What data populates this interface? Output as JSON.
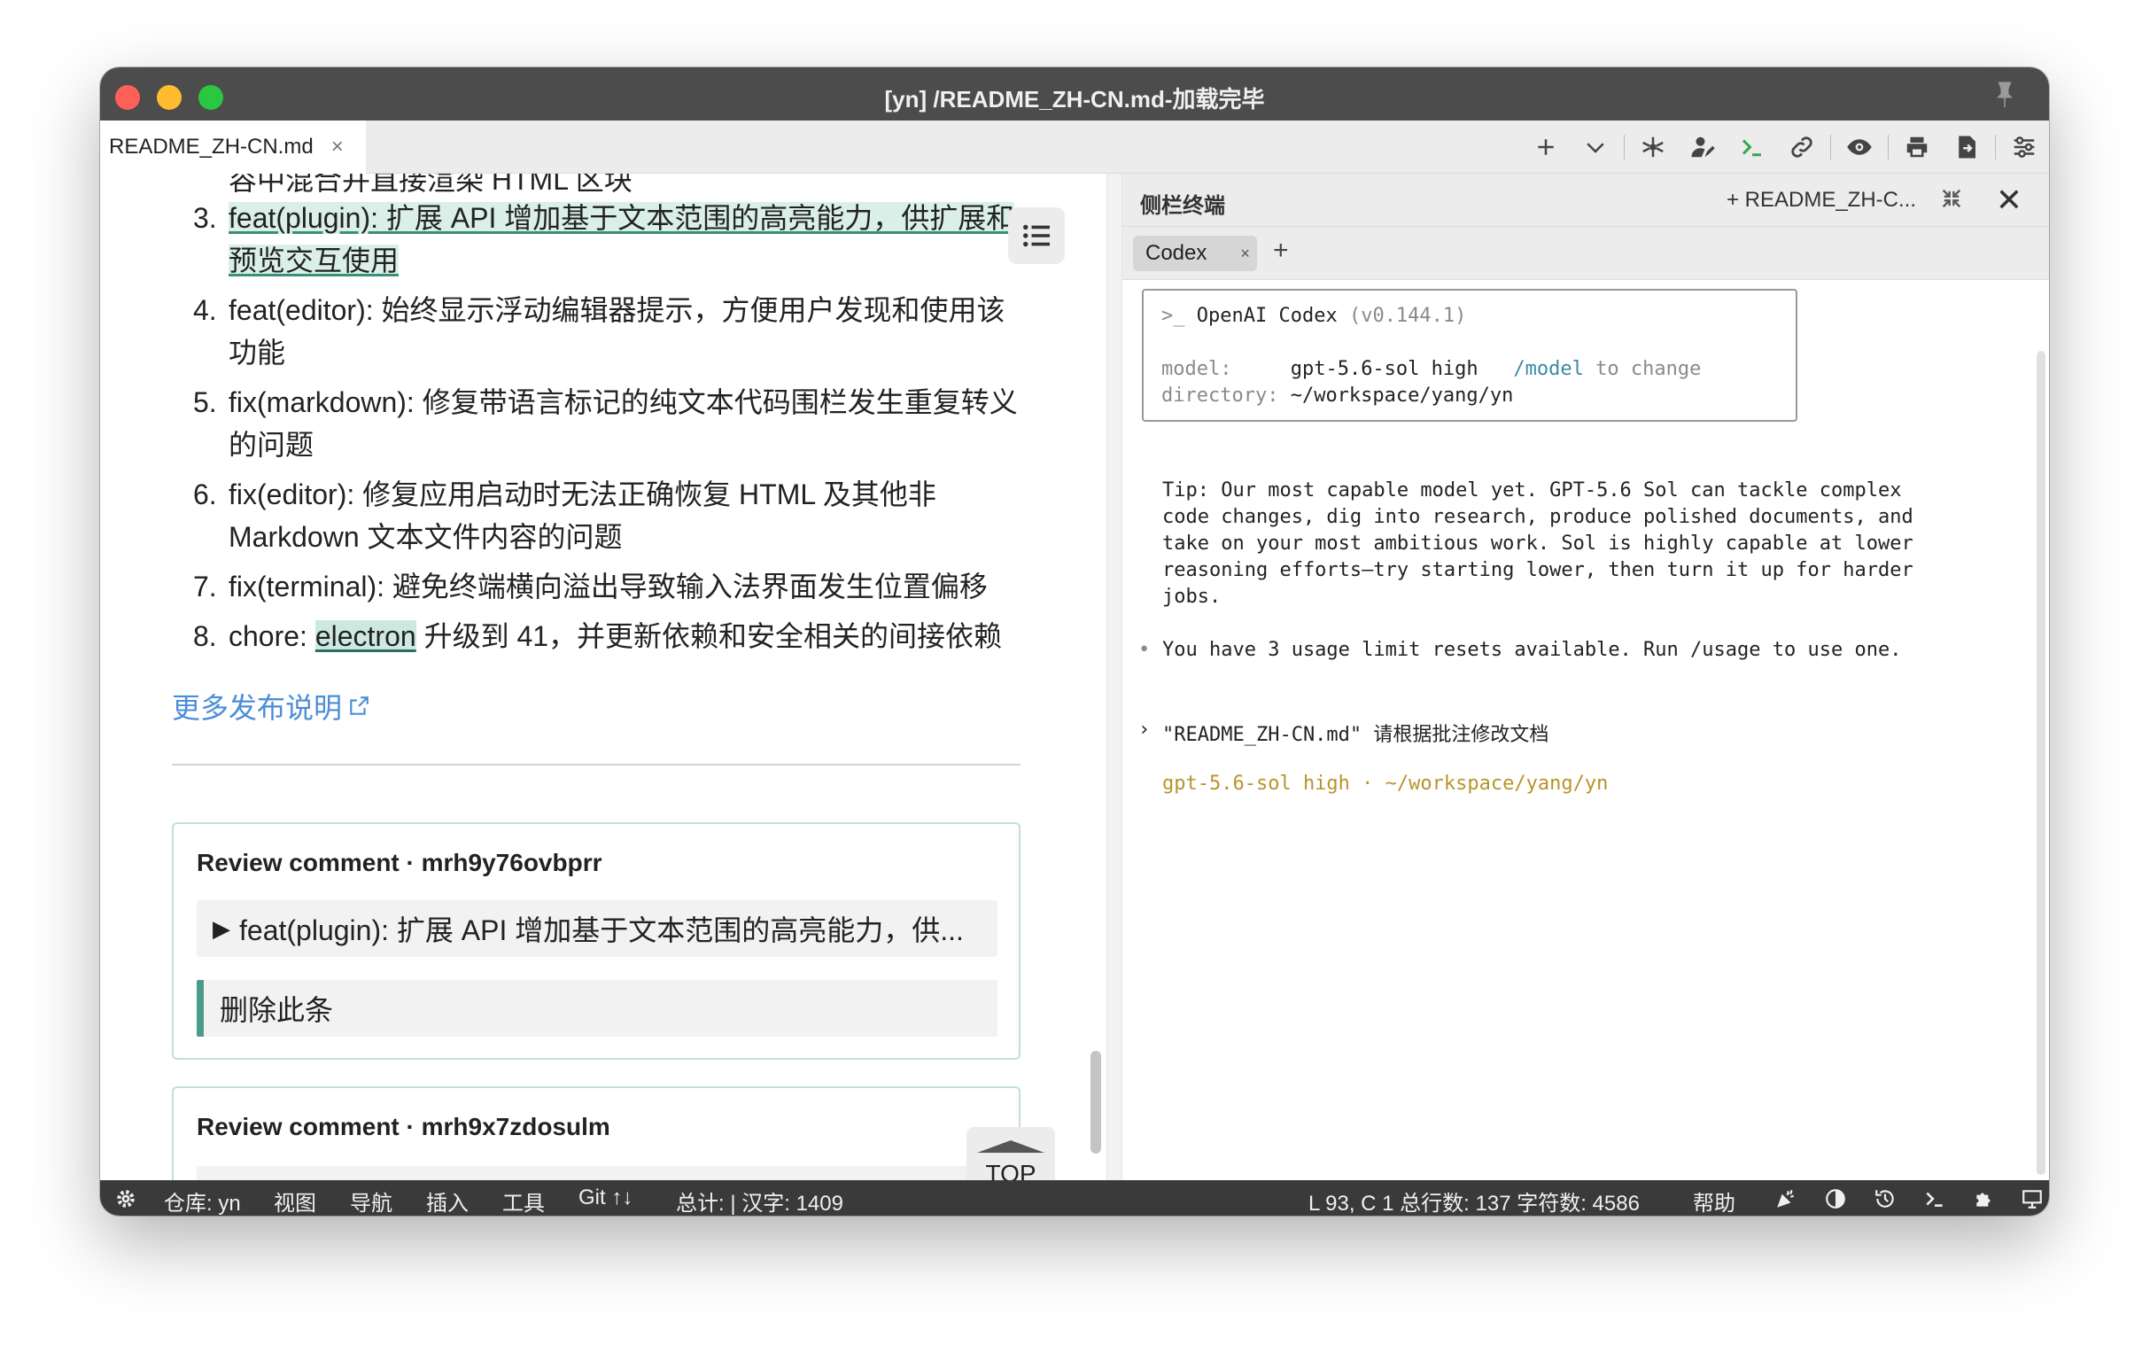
{
  "window": {
    "title": "[yn] /README_ZH-CN.md-加载完毕"
  },
  "tabs": [
    {
      "label": "README_ZH-CN.md",
      "close": "×"
    }
  ],
  "editor": {
    "cutoff_text": "容中混合并直接渲染 HTML 区块",
    "items": [
      {
        "num": "3.",
        "prefix": "",
        "hl": "feat(plugin): 扩展 API 增加基于文本范围的高亮能力，供扩展和预览交互使用",
        "rest": ""
      },
      {
        "num": "4.",
        "text": "feat(editor): 始终显示浮动编辑器提示，方便用户发现和使用该功能"
      },
      {
        "num": "5.",
        "text": "fix(markdown): 修复带语言标记的纯文本代码围栏发生重复转义的问题"
      },
      {
        "num": "6.",
        "text": "fix(editor): 修复应用启动时无法正确恢复 HTML 及其他非 Markdown 文本文件内容的问题"
      },
      {
        "num": "7.",
        "text": "fix(terminal): 避免终端横向溢出导致输入法界面发生位置偏移"
      },
      {
        "num": "8.",
        "prefix": "chore: ",
        "hl": "electron",
        "rest": " 升级到 41，并更新依赖和安全相关的间接依赖"
      }
    ],
    "more_link": "更多发布说明",
    "reviews": [
      {
        "title": "Review comment · mrh9y76ovbprr",
        "quote": "feat(plugin): 扩展 API 增加基于文本范围的高亮能力，供...",
        "body": "删除此条"
      },
      {
        "title": "Review comment · mrh9x7zdosulm"
      }
    ],
    "top_button": "TOP"
  },
  "terminal": {
    "title": "侧栏终端",
    "file_label": "+ README_ZH-C...",
    "tab_label": "Codex",
    "tab_close": "×",
    "add_tab": "+",
    "box": {
      "prompt": ">_",
      "app": "OpenAI Codex",
      "version": "(v0.144.1)",
      "model_key": "model:",
      "model_val": "gpt-5.6-sol high",
      "model_cmd": "/model",
      "model_hint": "to change",
      "dir_key": "directory:",
      "dir_val": "~/workspace/yang/yn"
    },
    "tip_lines": [
      "Tip: Our most capable model yet. GPT-5.6 Sol can tackle complex",
      "code changes, dig into research, produce polished documents, and",
      "take on your most ambitious work. Sol is highly capable at lower",
      "reasoning efforts—try starting lower, then turn it up for harder",
      "jobs."
    ],
    "usage_line": "You have 3 usage limit resets available. Run /usage to use one.",
    "bullet": "•",
    "prompt_marker": "›",
    "prompt_text": "\"README_ZH-CN.md\" 请根据批注修改文档",
    "status_line": "gpt-5.6-sol high · ~/workspace/yang/yn"
  },
  "statusbar": {
    "repo": "仓库: yn",
    "view": "视图",
    "nav": "导航",
    "insert": "插入",
    "tools": "工具",
    "git": "Git",
    "counts": "总计: | 汉字: 1409",
    "position": "L 93, C 1  总行数: 137  字符数: 4586",
    "help": "帮助"
  },
  "colors": {
    "titlebar": "#4c4c4c",
    "statusbar": "#3a3a3a",
    "highlight": "#d9efe8",
    "link": "#4a8ed8",
    "accent_green": "#4a9b8a"
  }
}
